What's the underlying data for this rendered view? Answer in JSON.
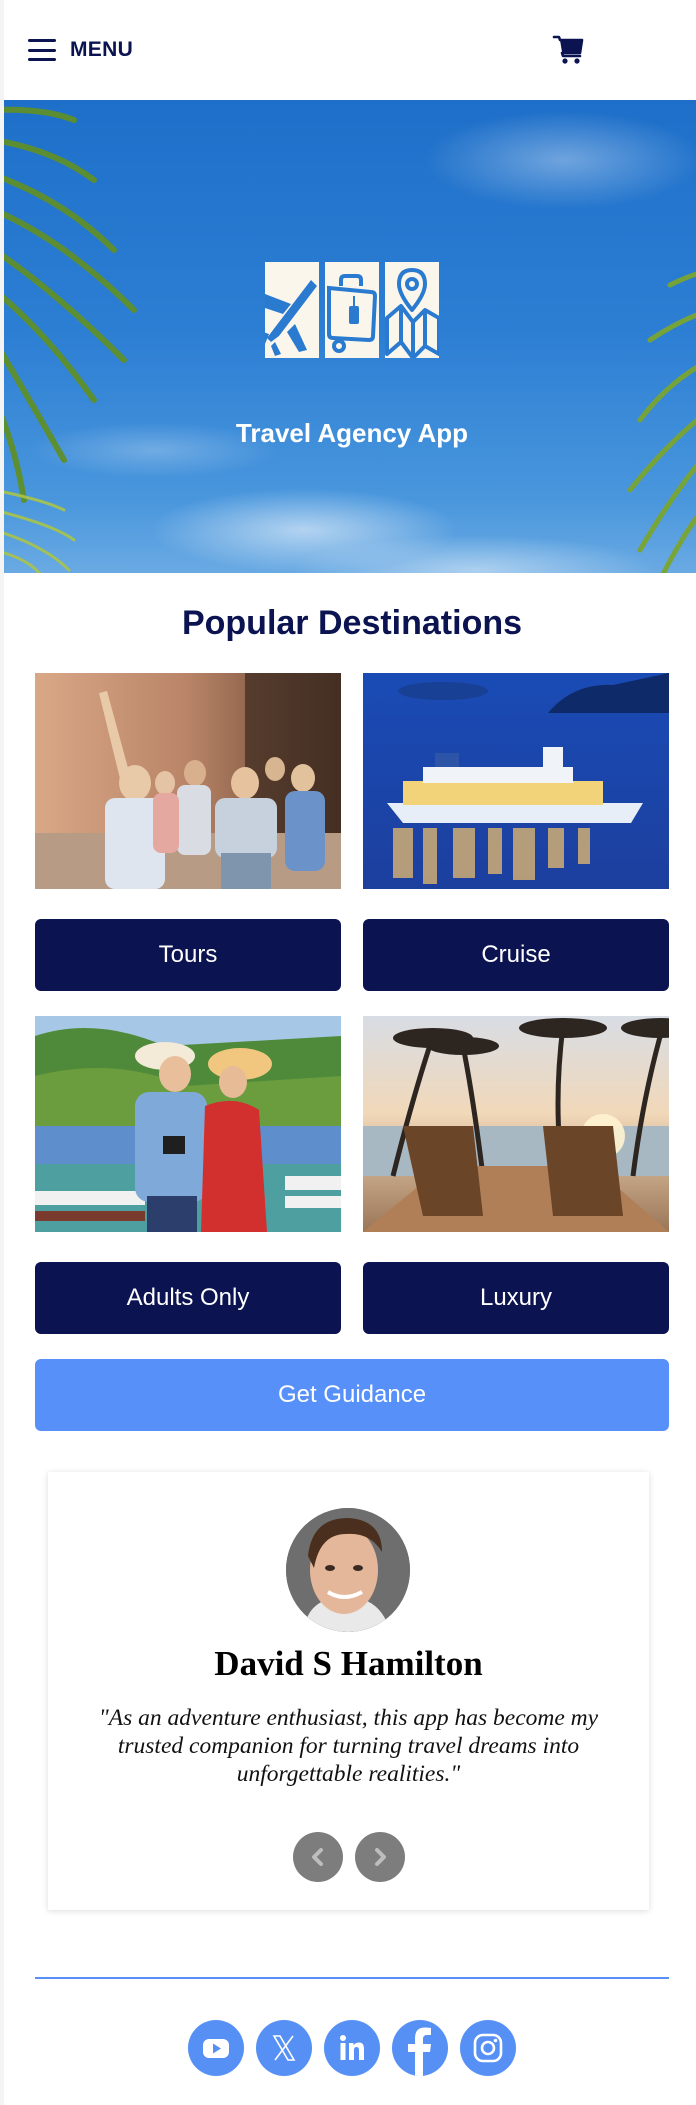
{
  "header": {
    "menu_label": "MENU",
    "menu_icon": "hamburger-icon",
    "cart_icon": "shopping-cart-icon"
  },
  "hero": {
    "title": "Travel Agency App",
    "logo_icons": [
      "airplane-icon",
      "suitcase-icon",
      "map-pin-icon"
    ]
  },
  "destinations": {
    "title": "Popular Destinations",
    "items": [
      {
        "label": "Tours",
        "image": "tour-group-photo"
      },
      {
        "label": "Cruise",
        "image": "cruise-ship-photo"
      },
      {
        "label": "Adults Only",
        "image": "couple-photo"
      },
      {
        "label": "Luxury",
        "image": "beach-resort-photo"
      }
    ],
    "cta_label": "Get Guidance"
  },
  "testimonial": {
    "name": "David S Hamilton",
    "quote": "\"As an adventure enthusiast, this app has become my trusted companion for turning travel dreams into unforgettable realities.\"",
    "prev_icon": "chevron-left-icon",
    "next_icon": "chevron-right-icon"
  },
  "footer": {
    "social": [
      "youtube",
      "x-twitter",
      "linkedin",
      "facebook",
      "instagram"
    ]
  },
  "colors": {
    "navy": "#0b1350",
    "accent_blue": "#5690f8",
    "social_blue": "#5690f5",
    "arrow_gray": "#7d7d7d"
  }
}
